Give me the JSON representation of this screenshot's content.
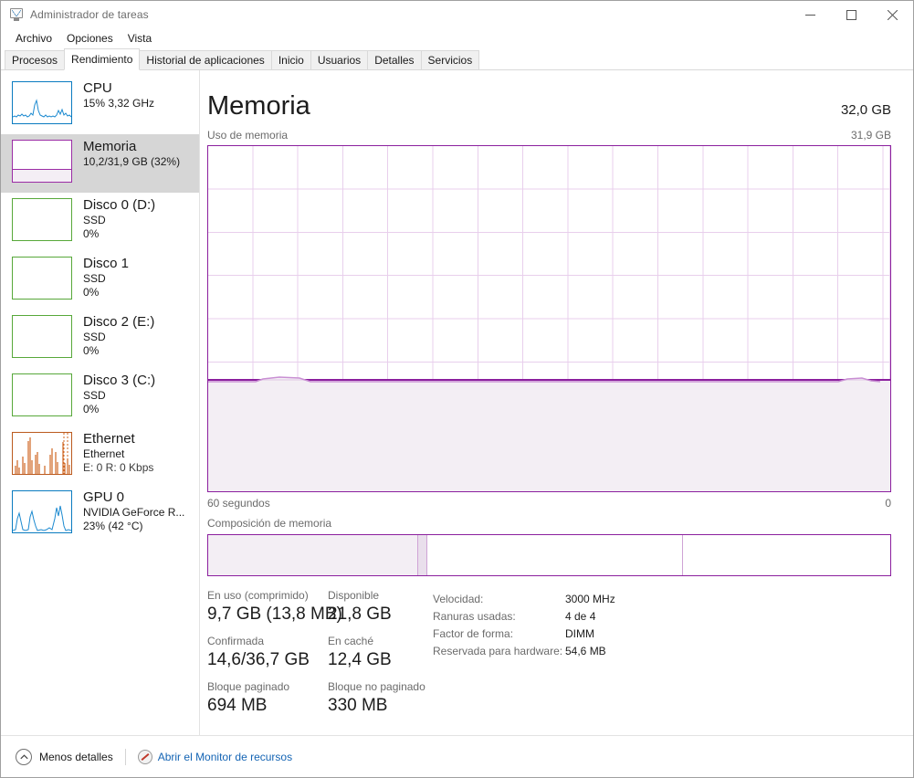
{
  "window": {
    "title": "Administrador de tareas",
    "icon": "task-manager-icon",
    "minimize_label": "—",
    "maximize_label": "□",
    "close_label": "✕"
  },
  "menu": {
    "items": [
      "Archivo",
      "Opciones",
      "Vista"
    ]
  },
  "tabs": [
    {
      "label": "Procesos",
      "active": false
    },
    {
      "label": "Rendimiento",
      "active": true
    },
    {
      "label": "Historial de aplicaciones",
      "active": false
    },
    {
      "label": "Inicio",
      "active": false
    },
    {
      "label": "Usuarios",
      "active": false
    },
    {
      "label": "Detalles",
      "active": false
    },
    {
      "label": "Servicios",
      "active": false
    }
  ],
  "sidebar": {
    "items": [
      {
        "name": "CPU",
        "line1": "15% 3,32 GHz",
        "line2": "",
        "color": "#0a7bc0",
        "kind": "spark-blue",
        "selected": false
      },
      {
        "name": "Memoria",
        "line1": "10,2/31,9 GB (32%)",
        "line2": "",
        "color": "#9b2ca5",
        "kind": "mem-fill",
        "selected": true
      },
      {
        "name": "Disco 0 (D:)",
        "line1": "SSD",
        "line2": "0%",
        "color": "#57a83a",
        "kind": "empty",
        "selected": false
      },
      {
        "name": "Disco 1",
        "line1": "SSD",
        "line2": "0%",
        "color": "#57a83a",
        "kind": "empty",
        "selected": false
      },
      {
        "name": "Disco 2 (E:)",
        "line1": "SSD",
        "line2": "0%",
        "color": "#57a83a",
        "kind": "empty",
        "selected": false
      },
      {
        "name": "Disco 3 (C:)",
        "line1": "SSD",
        "line2": "0%",
        "color": "#57a83a",
        "kind": "empty",
        "selected": false
      },
      {
        "name": "Ethernet",
        "line1": "Ethernet",
        "line2": "E: 0 R: 0 Kbps",
        "color": "#bb5a1e",
        "kind": "spark-orange",
        "selected": false
      },
      {
        "name": "GPU 0",
        "line1": "NVIDIA GeForce R...",
        "line2": "23%  (42 °C)",
        "color": "#0a7bc0",
        "kind": "spark-blue2",
        "selected": false
      }
    ]
  },
  "main": {
    "title": "Memoria",
    "total": "32,0 GB",
    "graph_label": "Uso de memoria",
    "graph_max": "31,9 GB",
    "axis_left": "60 segundos",
    "axis_right": "0",
    "composition_label": "Composición de memoria"
  },
  "chart_data": {
    "type": "area",
    "title": "Uso de memoria",
    "xlabel": "60 segundos",
    "ylabel": "",
    "ylim": [
      0,
      31.9
    ],
    "yaxis_max_label": "31,9 GB",
    "xaxis_left_label": "60 segundos",
    "xaxis_right_label": "0",
    "grid": true,
    "accent": "#8b1f9e",
    "fill": "#f3eef4",
    "series": [
      {
        "name": "Memoria en uso (GB)",
        "values": [
          10.2,
          10.2,
          10.2,
          10.2,
          10.2,
          10.3,
          10.4,
          10.4,
          10.3,
          10.2,
          10.2,
          10.2,
          10.2,
          10.2,
          10.2,
          10.2,
          10.2,
          10.2,
          10.2,
          10.2,
          10.2,
          10.2,
          10.2,
          10.2,
          10.2,
          10.2,
          10.2,
          10.2,
          10.2,
          10.2,
          10.2,
          10.2,
          10.2,
          10.2,
          10.2,
          10.2,
          10.2,
          10.2,
          10.2,
          10.2,
          10.2,
          10.2,
          10.2,
          10.2,
          10.2,
          10.2,
          10.2,
          10.2,
          10.2,
          10.2,
          10.2,
          10.2,
          10.3,
          10.3,
          10.2,
          10.2,
          10.2,
          10.2,
          10.2,
          10.2
        ]
      }
    ],
    "current_percent": 32
  },
  "composition": {
    "segments": [
      {
        "name": "en-uso",
        "percent": 30.6,
        "color": "#f3eef4"
      },
      {
        "name": "modificada",
        "percent": 1.2,
        "color": "#e9dfec"
      },
      {
        "name": "en-espera",
        "percent": 37.4,
        "color": "#ffffff"
      },
      {
        "name": "libre",
        "percent": 30.8,
        "color": "#ffffff"
      }
    ]
  },
  "stats": {
    "left": [
      {
        "label": "En uso (comprimido)",
        "value": "9,7 GB (13,8 MB)"
      },
      {
        "label": "Disponible",
        "value": "21,8 GB"
      },
      {
        "label": "Confirmada",
        "value": "14,6/36,7 GB"
      },
      {
        "label": "En caché",
        "value": "12,4 GB"
      },
      {
        "label": "Bloque paginado",
        "value": "694 MB"
      },
      {
        "label": "Bloque no paginado",
        "value": "330 MB"
      }
    ],
    "right": [
      {
        "key": "Velocidad:",
        "value": "3000 MHz"
      },
      {
        "key": "Ranuras usadas:",
        "value": "4 de 4"
      },
      {
        "key": "Factor de forma:",
        "value": "DIMM"
      },
      {
        "key": "Reservada para hardware:",
        "value": "54,6 MB"
      }
    ]
  },
  "footer": {
    "collapse_label": "Menos detalles",
    "collapse_icon": "chevron-up-icon",
    "resource_monitor_label": "Abrir el Monitor de recursos",
    "resource_monitor_icon": "resource-monitor-icon"
  }
}
